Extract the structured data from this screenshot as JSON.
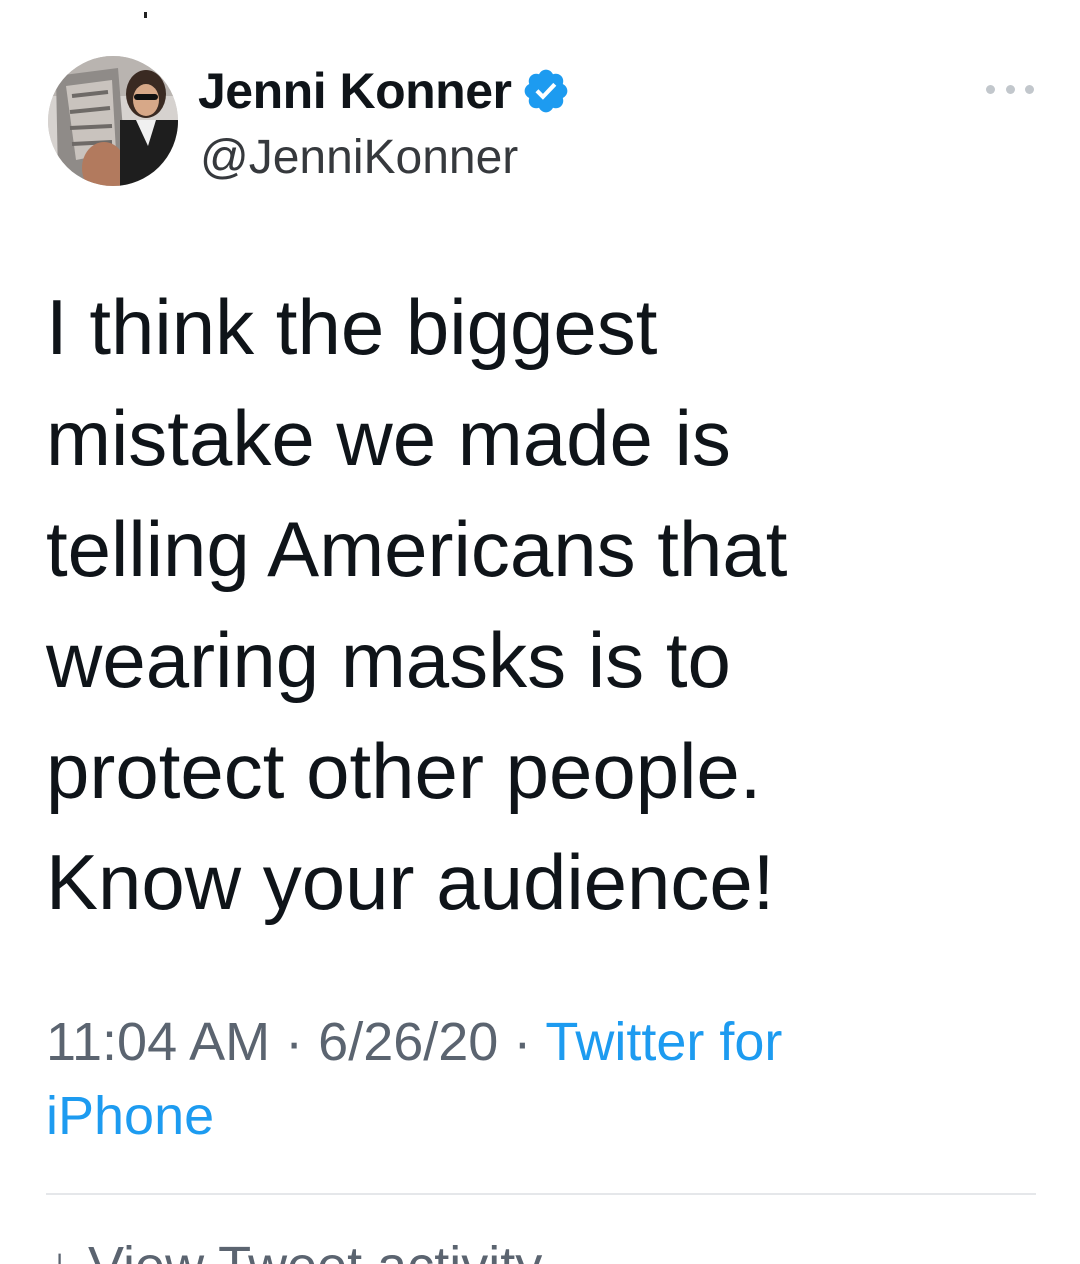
{
  "tweet": {
    "author": {
      "display_name": "Jenni Konner",
      "handle": "@JenniKonner",
      "verified": true
    },
    "text_lines": [
      "I think the biggest",
      "mistake we made is",
      "telling Americans that",
      "wearing masks is to",
      "protect other people.",
      "Know your audience!"
    ],
    "time": "11:04 AM",
    "separator": " · ",
    "date": "6/26/20",
    "source_line1": "Twitter for",
    "source_line2": "iPhone",
    "activity_label": "View Tweet activity"
  },
  "icons": {
    "verified": "verified-badge-icon",
    "more": "more-options-icon",
    "activity": "activity-chart-icon"
  },
  "colors": {
    "text": "#0f1419",
    "muted": "#5b6470",
    "accent": "#1d9bf0",
    "divider": "#e5e7ea"
  }
}
